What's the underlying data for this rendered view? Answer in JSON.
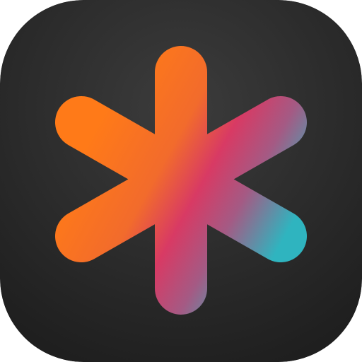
{
  "icon": {
    "name": "asterisk-app-icon",
    "glyph": "asterisk",
    "background": {
      "center": "#3c3c3c",
      "edge": "#1f1f1f"
    },
    "gradient": {
      "start": "#ff7a18",
      "mid_orange": "#f26b2c",
      "middle": "#d83a64",
      "mid_mauve": "#a45a84",
      "end": "#2fb4bf"
    }
  }
}
